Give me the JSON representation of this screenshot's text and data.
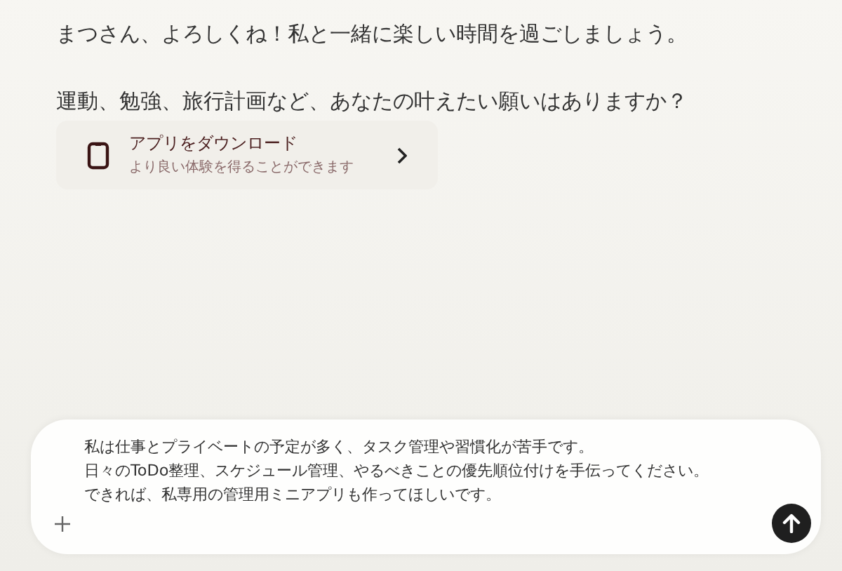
{
  "messages": [
    {
      "text": "まつさん、よろしくね！私と一緒に楽しい時間を過ごしましょう。"
    },
    {
      "text": "運動、勉強、旅行計画など、あなたの叶えたい願いはありますか？"
    }
  ],
  "app_card": {
    "title": "アプリをダウンロード",
    "subtitle": "より良い体験を得ることができます"
  },
  "input": {
    "lines": [
      "私は仕事とプライベートの予定が多く、タスク管理や習慣化が苦手です。",
      "日々のToDo整理、スケジュール管理、やるべきことの優先順位付けを手伝ってください。",
      "できれば、私専用の管理用ミニアプリも作ってほしいです。"
    ]
  }
}
